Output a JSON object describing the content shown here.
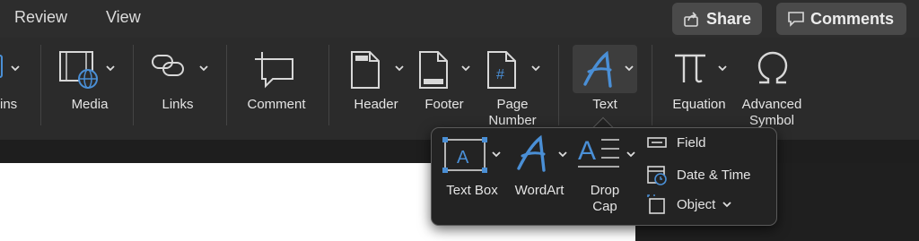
{
  "tabs": [
    {
      "label": "Review"
    },
    {
      "label": "View"
    }
  ],
  "actions": {
    "share": "Share",
    "comments": "Comments"
  },
  "ribbon": {
    "partial_label": "ins",
    "media": "Media",
    "links": "Links",
    "comment": "Comment",
    "header": "Header",
    "footer": "Footer",
    "page_number": {
      "line1": "Page",
      "line2": "Number"
    },
    "text": "Text",
    "equation": "Equation",
    "advanced_symbol": {
      "line1": "Advanced",
      "line2": "Symbol"
    }
  },
  "popup": {
    "text_box": "Text Box",
    "wordart": "WordArt",
    "drop_cap": {
      "line1": "Drop",
      "line2": "Cap"
    },
    "field": "Field",
    "date_time": "Date & Time",
    "object": "Object"
  },
  "icons": [
    "share-icon",
    "comments-icon",
    "media-icon",
    "links-icon",
    "comment-icon",
    "header-icon",
    "footer-icon",
    "page-number-icon",
    "text-icon",
    "pi-icon",
    "omega-icon",
    "text-box-icon",
    "wordart-icon",
    "drop-cap-icon",
    "field-icon",
    "date-time-icon",
    "object-icon"
  ],
  "colors": {
    "accent": "#4a8fd6",
    "ribbon": "#2b2b2b",
    "popup": "#232323"
  }
}
